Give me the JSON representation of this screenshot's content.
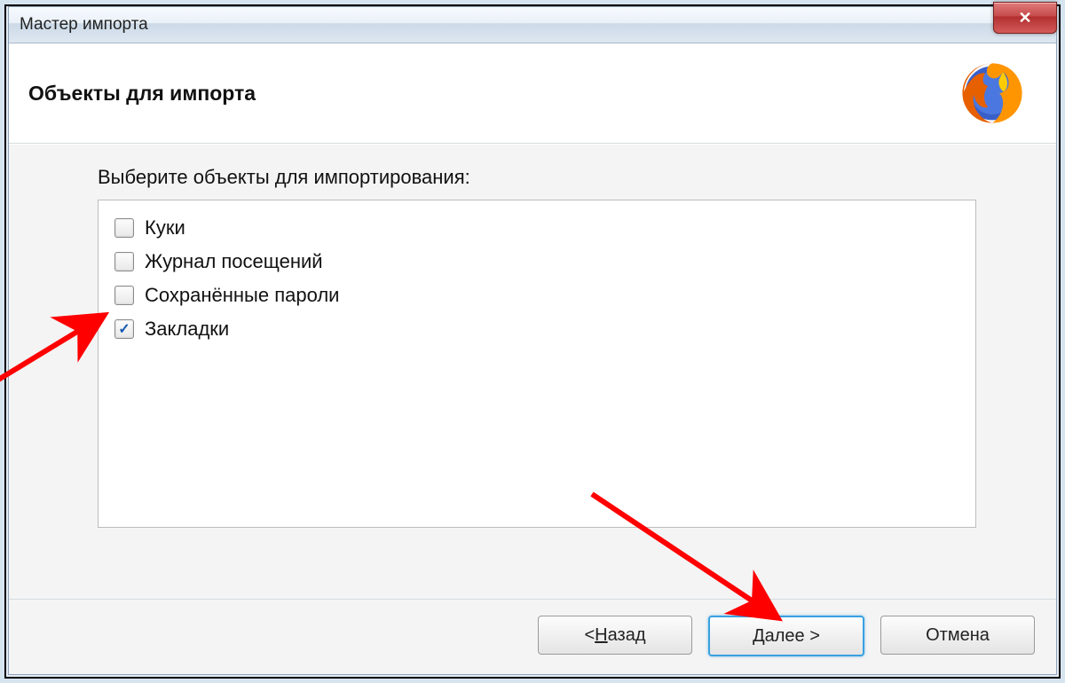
{
  "window": {
    "title": "Мастер импорта"
  },
  "header": {
    "title": "Объекты для импорта",
    "logo": "firefox-icon"
  },
  "content": {
    "prompt": "Выберите объекты для импортирования:",
    "items": [
      {
        "label": "Куки",
        "checked": false
      },
      {
        "label": "Журнал посещений",
        "checked": false
      },
      {
        "label": "Сохранённые пароли",
        "checked": false
      },
      {
        "label": "Закладки",
        "checked": true
      }
    ]
  },
  "footer": {
    "back": {
      "prefix": "< ",
      "mnemonic": "Н",
      "rest": "азад"
    },
    "next": {
      "mnemonic": "Д",
      "rest": "алее >"
    },
    "cancel": "Отмена"
  }
}
